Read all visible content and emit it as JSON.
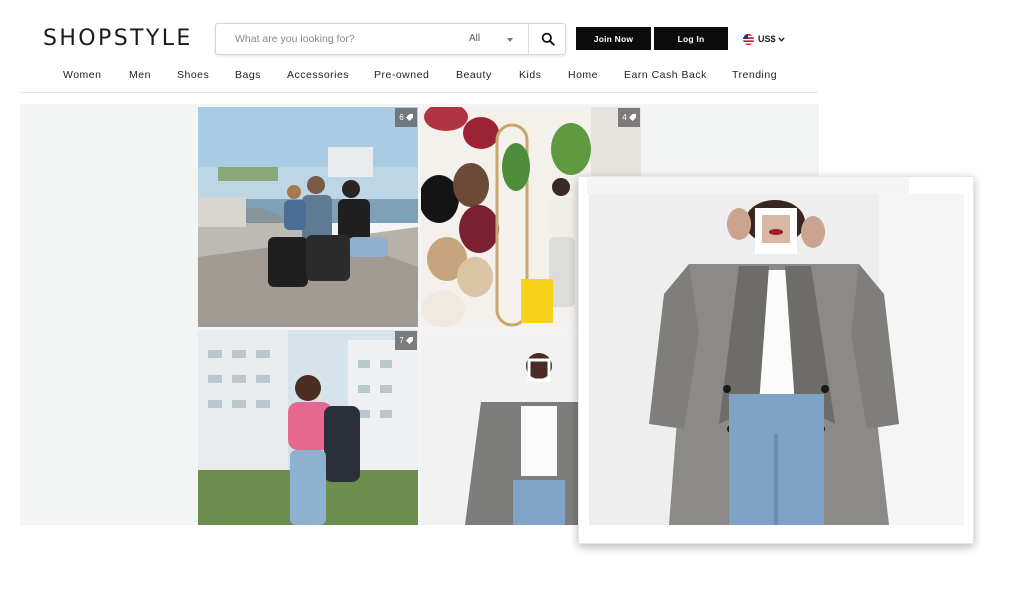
{
  "brand": {
    "logo_text": "SHOPSTYLE"
  },
  "search": {
    "placeholder": "What are you looking for?",
    "scope": "All",
    "icon": "search-icon"
  },
  "auth": {
    "join_label": "Join Now",
    "login_label": "Log In"
  },
  "currency": {
    "label": "US$",
    "flag": "us-flag-icon"
  },
  "nav": {
    "items": [
      "Women",
      "Men",
      "Shoes",
      "Bags",
      "Accessories",
      "Pre-owned",
      "Beauty",
      "Kids",
      "Home",
      "Earn Cash Back",
      "Trending"
    ]
  },
  "gallery": {
    "tiles": [
      {
        "badge": "6",
        "icon": "tag-icon"
      },
      {
        "badge": "4",
        "icon": "tag-icon"
      },
      {
        "badge": "7",
        "icon": "tag-icon"
      },
      {
        "badge": "",
        "icon": ""
      }
    ]
  },
  "colors": {
    "button_bg": "#0c0c0c",
    "gallery_bg": "#f3f4f4",
    "text": "#222222"
  }
}
